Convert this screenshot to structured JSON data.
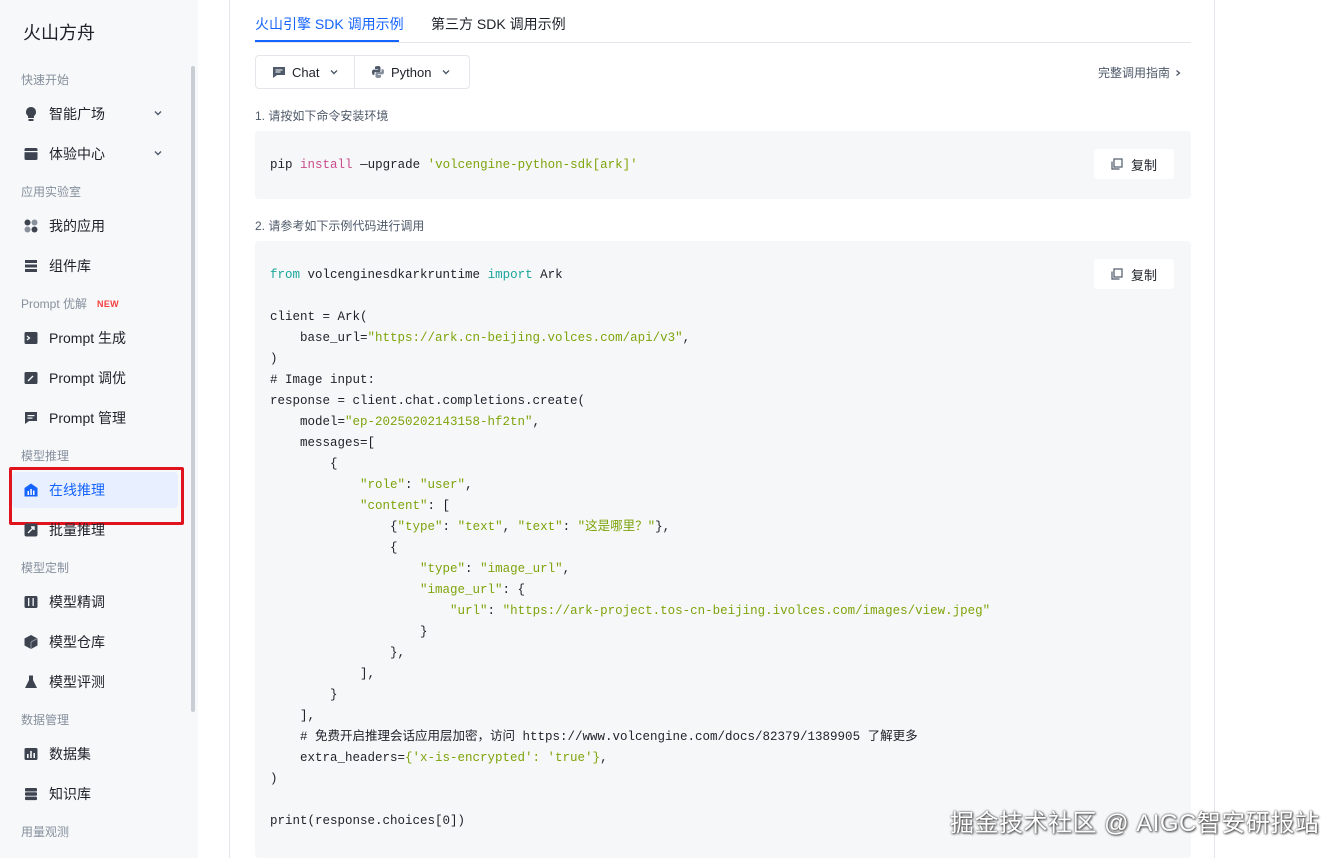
{
  "app": {
    "brand": "火山方舟"
  },
  "sidebar": {
    "sections": [
      {
        "label": "快速开始"
      },
      {
        "label": "应用实验室"
      },
      {
        "label": "Prompt 优解",
        "badge": "NEW"
      },
      {
        "label": "模型推理"
      },
      {
        "label": "模型定制"
      },
      {
        "label": "数据管理"
      },
      {
        "label": "用量观测"
      }
    ],
    "items": [
      {
        "label": "智能广场",
        "icon": "bulb-icon"
      },
      {
        "label": "体验中心",
        "icon": "box-icon"
      },
      {
        "label": "我的应用",
        "icon": "apps-icon"
      },
      {
        "label": "组件库",
        "icon": "stack-icon"
      },
      {
        "label": "Prompt 生成",
        "icon": "terminal-icon"
      },
      {
        "label": "Prompt 调优",
        "icon": "edit-icon"
      },
      {
        "label": "Prompt 管理",
        "icon": "message-icon"
      },
      {
        "label": "在线推理",
        "icon": "chart-icon"
      },
      {
        "label": "批量推理",
        "icon": "rocket-icon"
      },
      {
        "label": "模型精调",
        "icon": "sliders-icon"
      },
      {
        "label": "模型仓库",
        "icon": "cube-icon"
      },
      {
        "label": "模型评测",
        "icon": "flask-icon"
      },
      {
        "label": "数据集",
        "icon": "dataset-icon"
      },
      {
        "label": "知识库",
        "icon": "database-icon"
      }
    ],
    "active_item": "在线推理"
  },
  "tabs": [
    {
      "label": "火山引擎 SDK 调用示例"
    },
    {
      "label": "第三方 SDK 调用示例"
    }
  ],
  "selectors": {
    "mode": "Chat",
    "language": "Python"
  },
  "guide_link": "完整调用指南",
  "steps": {
    "step1": "1. 请按如下命令安装环境",
    "step2": "2. 请参考如下示例代码进行调用"
  },
  "copy_label": "复制",
  "install": {
    "pip": "pip",
    "install": "install",
    "flag": "—upgrade",
    "package": "'volcengine-python-sdk[ark]'"
  },
  "code": {
    "l1_from": "from",
    "l1_mod": "volcenginesdkarkruntime",
    "l1_import": "import",
    "l1_name": "Ark",
    "l3": "client = Ark(",
    "l4_key": "    base_url=",
    "l4_val": "\"https://ark.cn-beijing.volces.com/api/v3\"",
    "l4_end": ",",
    "l5": ")",
    "l6": "# Image input:",
    "l7": "response = client.chat.completions.create(",
    "l8_key": "    model=",
    "l8_val": "\"ep-20250202143158-hf2tn\"",
    "l8_end": ",",
    "l9": "    messages=[",
    "l10": "        {",
    "l11_a": "            ",
    "l11_k": "\"role\"",
    "l11_c": ": ",
    "l11_v": "\"user\"",
    "l11_e": ",",
    "l12_a": "            ",
    "l12_k": "\"content\"",
    "l12_e": ": [",
    "l13_a": "                {",
    "l13_k1": "\"type\"",
    "l13_c1": ": ",
    "l13_v1": "\"text\"",
    "l13_m": ", ",
    "l13_k2": "\"text\"",
    "l13_c2": ": ",
    "l13_v2": "\"这是哪里？\"",
    "l13_e": "},",
    "l14": "                {",
    "l15_a": "                    ",
    "l15_k": "\"type\"",
    "l15_c": ": ",
    "l15_v": "\"image_url\"",
    "l15_e": ",",
    "l16_a": "                    ",
    "l16_k": "\"image_url\"",
    "l16_e": ": {",
    "l17_a": "                        ",
    "l17_k": "\"url\"",
    "l17_c": ": ",
    "l17_v": "\"https://ark-project.tos-cn-beijing.ivolces.com/images/view.jpeg\"",
    "l18": "                    }",
    "l19": "                },",
    "l20": "            ],",
    "l21": "        }",
    "l22": "    ],",
    "l23": "    # 免费开启推理会话应用层加密，访问 https://www.volcengine.com/docs/82379/1389905 了解更多",
    "l24_key": "    extra_headers=",
    "l24_v": "{'x-is-encrypted': 'true'}",
    "l24_e": ",",
    "l25": ")",
    "l27": "print(response.choices[0])"
  },
  "watermark": "掘金技术社区 @ AIGC智安研报站",
  "colors": {
    "accent": "#1664ff",
    "highlight_border": "#e0141e",
    "keyword": "#1aa69b",
    "string": "#7ea40b",
    "shell_keyword": "#c94d8a"
  }
}
